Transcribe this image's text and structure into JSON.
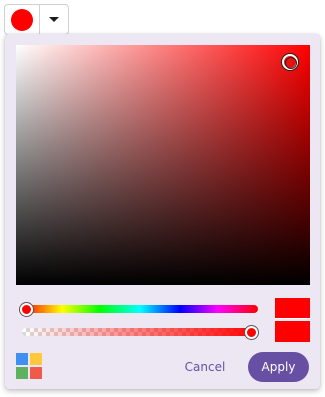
{
  "color_picker": {
    "selected_color": "#ff0000",
    "hue_value": "#ff0000",
    "opacity": 1,
    "current_color": "#ff0000",
    "new_color": "#ff0000",
    "accent_color": "#6750a4",
    "mode_switch_colors": [
      "#3f8ff5",
      "#ffc83d",
      "#5fb15f",
      "#f15a4a"
    ],
    "cancel_label": "Cancel",
    "apply_label": "Apply"
  }
}
